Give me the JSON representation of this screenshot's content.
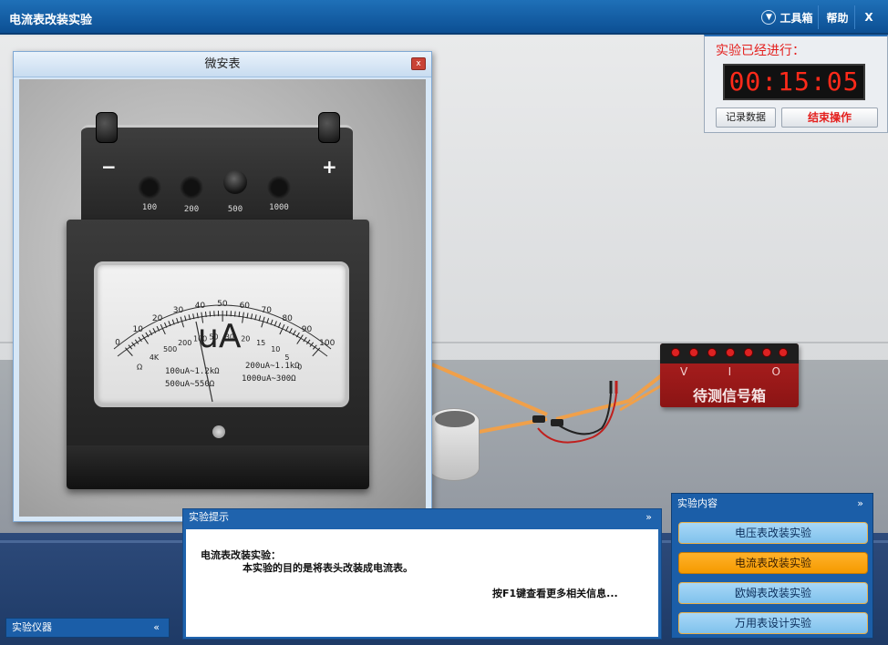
{
  "app": {
    "title": "电流表改装实验"
  },
  "toolbar": {
    "toolbox_label": "工具箱",
    "help_label": "帮助",
    "close_label": "X",
    "toolbox_icon": "chevron-down-circle"
  },
  "timer": {
    "label": "实验已经进行：",
    "time": "00:15:05",
    "record_label": "记录数据",
    "end_label": "结束操作"
  },
  "meter_window": {
    "title": "微安表",
    "close_label": "x",
    "minus": "−",
    "plus": "+",
    "jacks": [
      "100",
      "200",
      "500",
      "1000"
    ],
    "unit": "uA",
    "scale_labels": [
      "0",
      "10",
      "20",
      "30",
      "40",
      "50",
      "60",
      "70",
      "80",
      "90",
      "100"
    ],
    "ohm_labels": [
      "Ω",
      "4K",
      "500",
      "200",
      "100",
      "50",
      "30",
      "20",
      "15",
      "10",
      "5",
      "0"
    ],
    "ranges": [
      "100uA~1.2kΩ",
      "200uA~1.1kΩ",
      "500uA~550Ω",
      "1000uA~300Ω"
    ]
  },
  "signal_box": {
    "terminals": [
      "V",
      "I",
      "O"
    ],
    "label": "待测信号箱"
  },
  "tips": {
    "header": "实验提示",
    "line1": "电流表改装实验：",
    "line2": "本实验的目的是将表头改装成电流表。",
    "line3": "按F1键查看更多相关信息..."
  },
  "experiments": {
    "header": "实验内容",
    "items": [
      {
        "label": "电压表改装实验",
        "active": false
      },
      {
        "label": "电流表改装实验",
        "active": true
      },
      {
        "label": "欧姆表改装实验",
        "active": false
      },
      {
        "label": "万用表设计实验",
        "active": false
      }
    ]
  },
  "instruments": {
    "header": "实验仪器"
  },
  "colors": {
    "titlebar": "#1566b0",
    "timer_digits": "#ff2a1a",
    "active_item": "#f59a00",
    "item": "#8fcaf0",
    "wires": "#f0a04a"
  }
}
